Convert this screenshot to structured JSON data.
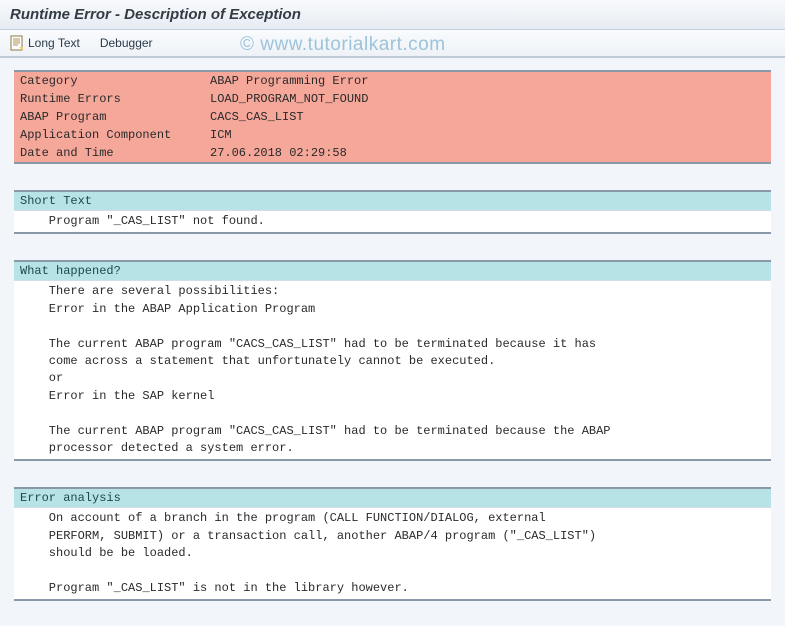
{
  "header": {
    "title": "Runtime Error - Description of Exception"
  },
  "toolbar": {
    "long_text": "Long Text",
    "debugger": "Debugger"
  },
  "info": {
    "rows": [
      {
        "label": "Category",
        "value": "ABAP Programming Error"
      },
      {
        "label": "Runtime Errors",
        "value": "LOAD_PROGRAM_NOT_FOUND"
      },
      {
        "label": "ABAP Program",
        "value": "CACS_CAS_LIST"
      },
      {
        "label": "Application Component",
        "value": "ICM"
      },
      {
        "label": "Date and Time",
        "value": "27.06.2018 02:29:58"
      }
    ]
  },
  "sections": {
    "short_text": {
      "title": "Short Text",
      "body": "    Program \"_CAS_LIST\" not found."
    },
    "what_happened": {
      "title": "What happened?",
      "body": "    There are several possibilities:\n    Error in the ABAP Application Program\n\n    The current ABAP program \"CACS_CAS_LIST\" had to be terminated because it has\n    come across a statement that unfortunately cannot be executed.\n    or\n    Error in the SAP kernel\n\n    The current ABAP program \"CACS_CAS_LIST\" had to be terminated because the ABAP\n    processor detected a system error."
    },
    "error_analysis": {
      "title": "Error analysis",
      "body": "    On account of a branch in the program (CALL FUNCTION/DIALOG, external\n    PERFORM, SUBMIT) or a transaction call, another ABAP/4 program (\"_CAS_LIST\")\n    should be be loaded.\n\n    Program \"_CAS_LIST\" is not in the library however."
    }
  },
  "watermark": "©  www.tutorialkart.com"
}
